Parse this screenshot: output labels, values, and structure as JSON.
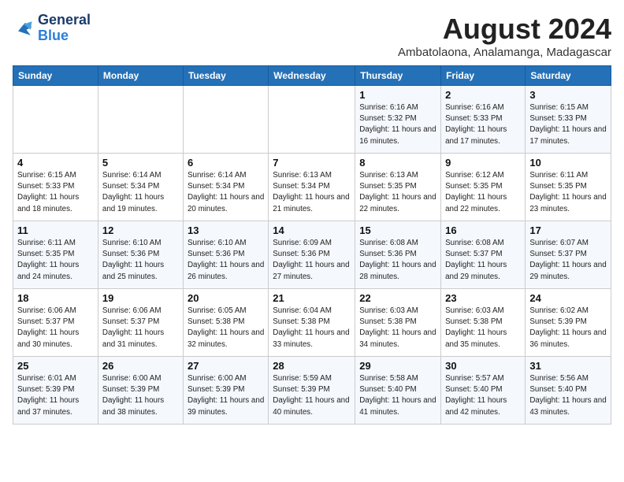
{
  "logo": {
    "line1": "General",
    "line2": "Blue"
  },
  "title": "August 2024",
  "location": "Ambatolaona, Analamanga, Madagascar",
  "days_of_week": [
    "Sunday",
    "Monday",
    "Tuesday",
    "Wednesday",
    "Thursday",
    "Friday",
    "Saturday"
  ],
  "weeks": [
    [
      {
        "day": "",
        "info": ""
      },
      {
        "day": "",
        "info": ""
      },
      {
        "day": "",
        "info": ""
      },
      {
        "day": "",
        "info": ""
      },
      {
        "day": "1",
        "info": "Sunrise: 6:16 AM\nSunset: 5:32 PM\nDaylight: 11 hours and 16 minutes."
      },
      {
        "day": "2",
        "info": "Sunrise: 6:16 AM\nSunset: 5:33 PM\nDaylight: 11 hours and 17 minutes."
      },
      {
        "day": "3",
        "info": "Sunrise: 6:15 AM\nSunset: 5:33 PM\nDaylight: 11 hours and 17 minutes."
      }
    ],
    [
      {
        "day": "4",
        "info": "Sunrise: 6:15 AM\nSunset: 5:33 PM\nDaylight: 11 hours and 18 minutes."
      },
      {
        "day": "5",
        "info": "Sunrise: 6:14 AM\nSunset: 5:34 PM\nDaylight: 11 hours and 19 minutes."
      },
      {
        "day": "6",
        "info": "Sunrise: 6:14 AM\nSunset: 5:34 PM\nDaylight: 11 hours and 20 minutes."
      },
      {
        "day": "7",
        "info": "Sunrise: 6:13 AM\nSunset: 5:34 PM\nDaylight: 11 hours and 21 minutes."
      },
      {
        "day": "8",
        "info": "Sunrise: 6:13 AM\nSunset: 5:35 PM\nDaylight: 11 hours and 22 minutes."
      },
      {
        "day": "9",
        "info": "Sunrise: 6:12 AM\nSunset: 5:35 PM\nDaylight: 11 hours and 22 minutes."
      },
      {
        "day": "10",
        "info": "Sunrise: 6:11 AM\nSunset: 5:35 PM\nDaylight: 11 hours and 23 minutes."
      }
    ],
    [
      {
        "day": "11",
        "info": "Sunrise: 6:11 AM\nSunset: 5:35 PM\nDaylight: 11 hours and 24 minutes."
      },
      {
        "day": "12",
        "info": "Sunrise: 6:10 AM\nSunset: 5:36 PM\nDaylight: 11 hours and 25 minutes."
      },
      {
        "day": "13",
        "info": "Sunrise: 6:10 AM\nSunset: 5:36 PM\nDaylight: 11 hours and 26 minutes."
      },
      {
        "day": "14",
        "info": "Sunrise: 6:09 AM\nSunset: 5:36 PM\nDaylight: 11 hours and 27 minutes."
      },
      {
        "day": "15",
        "info": "Sunrise: 6:08 AM\nSunset: 5:36 PM\nDaylight: 11 hours and 28 minutes."
      },
      {
        "day": "16",
        "info": "Sunrise: 6:08 AM\nSunset: 5:37 PM\nDaylight: 11 hours and 29 minutes."
      },
      {
        "day": "17",
        "info": "Sunrise: 6:07 AM\nSunset: 5:37 PM\nDaylight: 11 hours and 29 minutes."
      }
    ],
    [
      {
        "day": "18",
        "info": "Sunrise: 6:06 AM\nSunset: 5:37 PM\nDaylight: 11 hours and 30 minutes."
      },
      {
        "day": "19",
        "info": "Sunrise: 6:06 AM\nSunset: 5:37 PM\nDaylight: 11 hours and 31 minutes."
      },
      {
        "day": "20",
        "info": "Sunrise: 6:05 AM\nSunset: 5:38 PM\nDaylight: 11 hours and 32 minutes."
      },
      {
        "day": "21",
        "info": "Sunrise: 6:04 AM\nSunset: 5:38 PM\nDaylight: 11 hours and 33 minutes."
      },
      {
        "day": "22",
        "info": "Sunrise: 6:03 AM\nSunset: 5:38 PM\nDaylight: 11 hours and 34 minutes."
      },
      {
        "day": "23",
        "info": "Sunrise: 6:03 AM\nSunset: 5:38 PM\nDaylight: 11 hours and 35 minutes."
      },
      {
        "day": "24",
        "info": "Sunrise: 6:02 AM\nSunset: 5:39 PM\nDaylight: 11 hours and 36 minutes."
      }
    ],
    [
      {
        "day": "25",
        "info": "Sunrise: 6:01 AM\nSunset: 5:39 PM\nDaylight: 11 hours and 37 minutes."
      },
      {
        "day": "26",
        "info": "Sunrise: 6:00 AM\nSunset: 5:39 PM\nDaylight: 11 hours and 38 minutes."
      },
      {
        "day": "27",
        "info": "Sunrise: 6:00 AM\nSunset: 5:39 PM\nDaylight: 11 hours and 39 minutes."
      },
      {
        "day": "28",
        "info": "Sunrise: 5:59 AM\nSunset: 5:39 PM\nDaylight: 11 hours and 40 minutes."
      },
      {
        "day": "29",
        "info": "Sunrise: 5:58 AM\nSunset: 5:40 PM\nDaylight: 11 hours and 41 minutes."
      },
      {
        "day": "30",
        "info": "Sunrise: 5:57 AM\nSunset: 5:40 PM\nDaylight: 11 hours and 42 minutes."
      },
      {
        "day": "31",
        "info": "Sunrise: 5:56 AM\nSunset: 5:40 PM\nDaylight: 11 hours and 43 minutes."
      }
    ]
  ]
}
